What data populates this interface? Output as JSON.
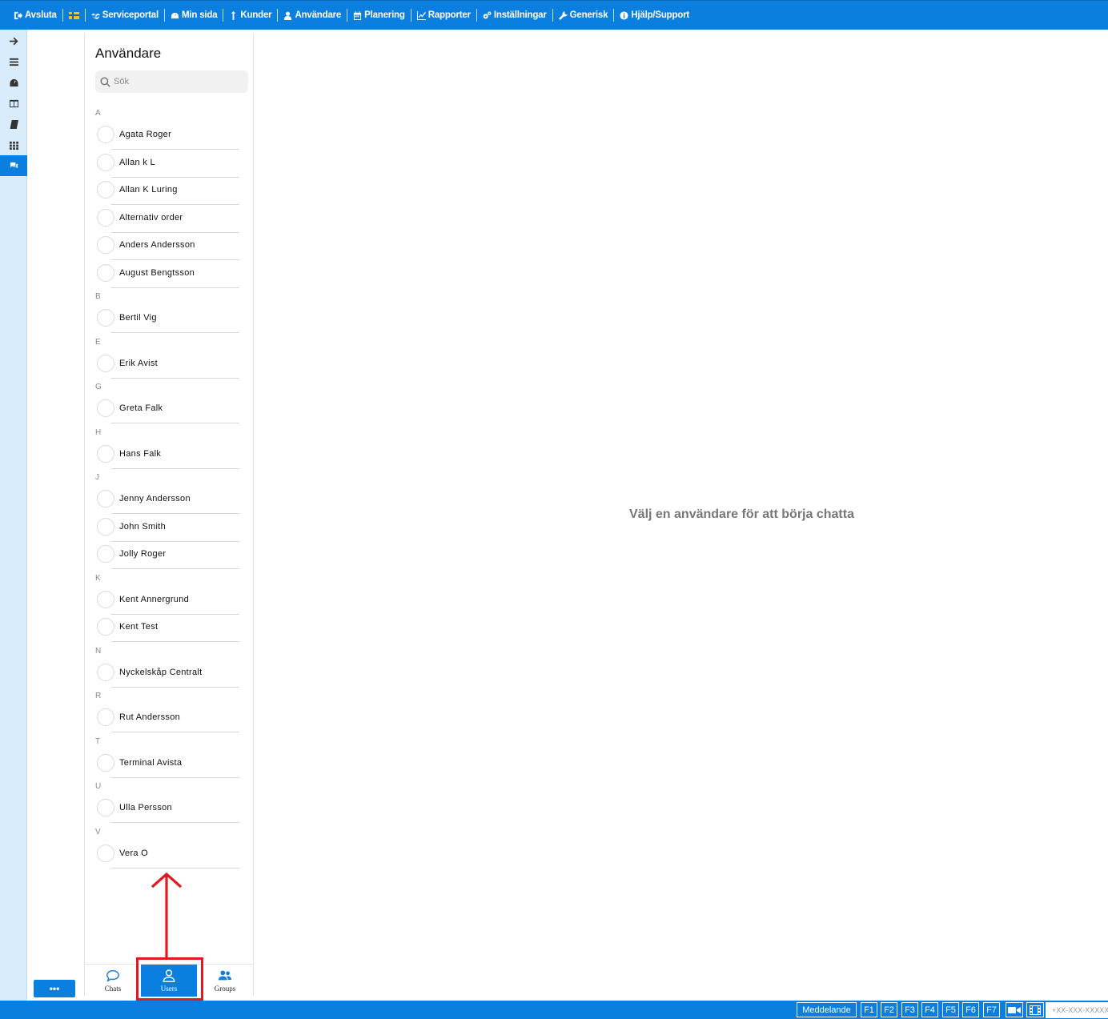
{
  "topbar": {
    "items": [
      {
        "label": "Avsluta",
        "icon": "logout-icon"
      },
      {
        "label": "",
        "icon": "flag-se-icon"
      },
      {
        "label": "Serviceportal",
        "icon": "handshake-icon"
      },
      {
        "label": "Min sida",
        "icon": "dashboard-icon"
      },
      {
        "label": "Kunder",
        "icon": "person-up-icon"
      },
      {
        "label": "Användare",
        "icon": "user-icon"
      },
      {
        "label": "Planering",
        "icon": "calendar-icon"
      },
      {
        "label": "Rapporter",
        "icon": "chart-line-icon"
      },
      {
        "label": "Inställningar",
        "icon": "cogs-icon"
      },
      {
        "label": "Generisk",
        "icon": "wrench-icon"
      },
      {
        "label": "Hjälp/Support",
        "icon": "info-icon"
      }
    ]
  },
  "rail": {
    "icons": [
      "arrow-right-icon",
      "list-icon",
      "dashboard-icon",
      "columns-icon",
      "book-icon",
      "grid-icon",
      "chat-icon"
    ],
    "active_index": 6
  },
  "more_button": {
    "label": "•••"
  },
  "panel": {
    "title": "Användare",
    "search_placeholder": "Sök",
    "groups": [
      {
        "letter": "A",
        "users": [
          "Agata Roger",
          "Allan k L",
          "Allan K Luring",
          "Alternativ order",
          "Anders Andersson",
          "August Bengtsson"
        ]
      },
      {
        "letter": "B",
        "users": [
          "Bertil Vig"
        ]
      },
      {
        "letter": "E",
        "users": [
          "Erik Avist"
        ]
      },
      {
        "letter": "G",
        "users": [
          "Greta Falk"
        ]
      },
      {
        "letter": "H",
        "users": [
          "Hans Falk"
        ]
      },
      {
        "letter": "J",
        "users": [
          "Jenny Andersson",
          "John Smith",
          "Jolly Roger"
        ]
      },
      {
        "letter": "K",
        "users": [
          "Kent Annergrund",
          "Kent Test"
        ]
      },
      {
        "letter": "N",
        "users": [
          "Nyckelskåp Centralt"
        ]
      },
      {
        "letter": "R",
        "users": [
          "Rut Andersson"
        ]
      },
      {
        "letter": "T",
        "users": [
          "Terminal Avista"
        ]
      },
      {
        "letter": "U",
        "users": [
          "Ulla Persson"
        ]
      },
      {
        "letter": "V",
        "users": [
          "Vera O"
        ]
      }
    ],
    "tabs": [
      {
        "label": "Chats",
        "icon": "chat-bubble-icon"
      },
      {
        "label": "Users",
        "icon": "user-icon",
        "active": true
      },
      {
        "label": "Groups",
        "icon": "users-group-icon"
      }
    ]
  },
  "main": {
    "message": "Välj en användare för att börja chatta"
  },
  "bottombar": {
    "message_label": "Meddelande",
    "fkeys": [
      "F1",
      "F2",
      "F3",
      "F4",
      "F5",
      "F6",
      "F7"
    ],
    "phone": "+XX-XXX-XXXXX",
    "icons": [
      "video-camera-icon",
      "film-icon"
    ]
  },
  "colors": {
    "accent": "#0a7fe0",
    "rail_bg": "#d9ecfb",
    "annotation": "#e01a22"
  }
}
